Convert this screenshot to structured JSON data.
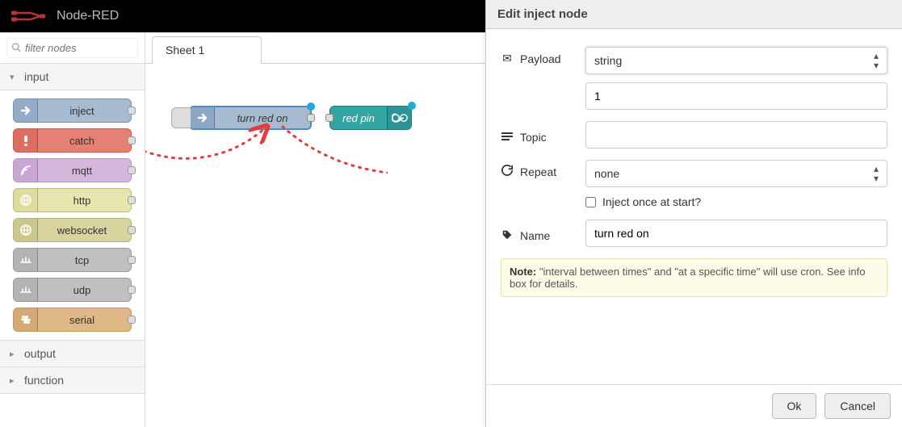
{
  "app_title": "Node-RED",
  "palette": {
    "search_placeholder": "filter nodes",
    "categories": [
      {
        "key": "input",
        "label": "input",
        "expanded": true
      },
      {
        "key": "output",
        "label": "output",
        "expanded": false
      },
      {
        "key": "function",
        "label": "function",
        "expanded": false
      }
    ],
    "input_nodes": [
      {
        "key": "inject",
        "label": "inject"
      },
      {
        "key": "catch",
        "label": "catch"
      },
      {
        "key": "mqtt",
        "label": "mqtt"
      },
      {
        "key": "http",
        "label": "http"
      },
      {
        "key": "websocket",
        "label": "websocket"
      },
      {
        "key": "tcp",
        "label": "tcp"
      },
      {
        "key": "udp",
        "label": "udp"
      },
      {
        "key": "serial",
        "label": "serial"
      }
    ]
  },
  "workspace": {
    "tab_label": "Sheet 1",
    "nodes": {
      "inject_label": "turn red on",
      "redpin_label": "red pin"
    }
  },
  "edit_panel": {
    "title": "Edit inject node",
    "fields": {
      "payload_label": "Payload",
      "payload_type": "string",
      "payload_value": "1",
      "topic_label": "Topic",
      "topic_value": "",
      "repeat_label": "Repeat",
      "repeat_value": "none",
      "inject_once_label": "Inject once at start?",
      "inject_once_checked": false,
      "name_label": "Name",
      "name_value": "turn red on"
    },
    "note_strong": "Note:",
    "note_text": " \"interval between times\" and \"at a specific time\" will use cron. See info box for details.",
    "ok_label": "Ok",
    "cancel_label": "Cancel"
  }
}
